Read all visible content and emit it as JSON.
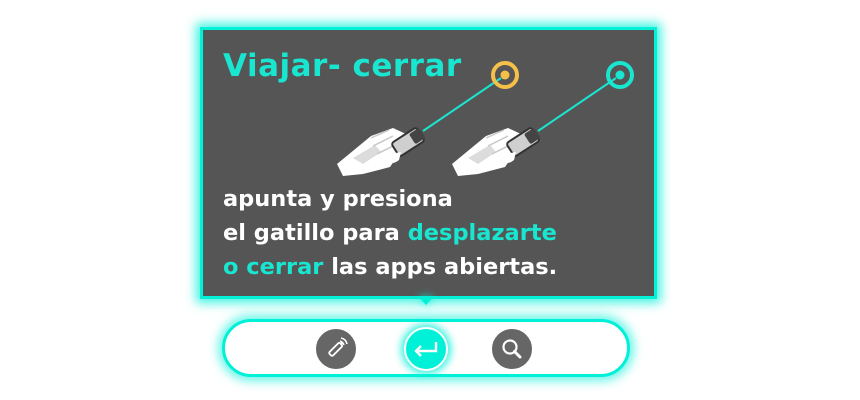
{
  "panel": {
    "title": "Viajar- cerrar",
    "line1": "apunta y presiona",
    "line2_start": "el gatillo para ",
    "line2_highlight": "desplazarte",
    "line3_highlight": "o cerrar",
    "line3_end": " las apps abiertas."
  },
  "illustration": {
    "target_1_color": "#f5c04a",
    "target_2_color": "#19e6d0",
    "beam_color": "#19e6d0"
  },
  "dock": {
    "buttons": [
      {
        "icon": "laser-pointer-icon",
        "active": false
      },
      {
        "icon": "enter-icon",
        "active": true
      },
      {
        "icon": "search-icon",
        "active": false
      }
    ]
  },
  "colors": {
    "accent": "#00f0d8",
    "panel_bg": "#555555",
    "highlight_text": "#19e6d0",
    "button_bg": "#666666"
  }
}
